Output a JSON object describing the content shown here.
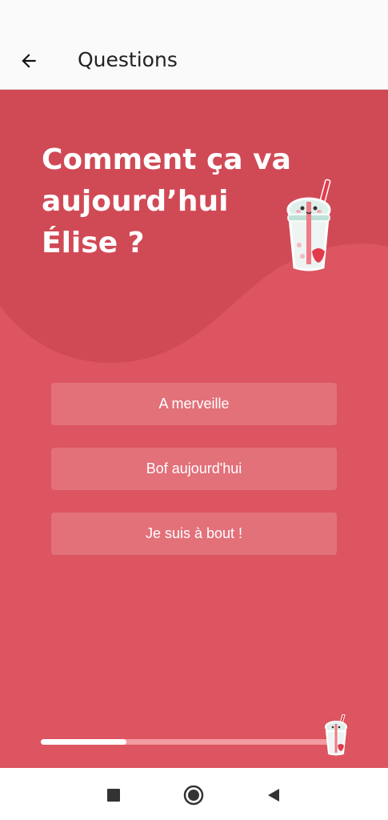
{
  "appbar": {
    "title": "Questions",
    "back_icon": "arrow-left-icon"
  },
  "question": {
    "lines": [
      "Comment ça va",
      "aujourd’hui",
      "Élise ?"
    ],
    "mascot_icon": "bubble-tea-cup-icon"
  },
  "answers": [
    {
      "label": "A merveille"
    },
    {
      "label": "Bof aujourd'hui"
    },
    {
      "label": "Je suis à bout !"
    }
  ],
  "progress": {
    "fraction": 0.29,
    "marker_icon": "bubble-tea-cup-icon"
  },
  "navbar": {
    "items": [
      "recents-square-icon",
      "home-circle-icon",
      "back-triangle-icon"
    ]
  },
  "colors": {
    "background": "#dc5560",
    "wave": "#d04a56",
    "appbar": "#fafafa",
    "text": "#ffffff"
  }
}
